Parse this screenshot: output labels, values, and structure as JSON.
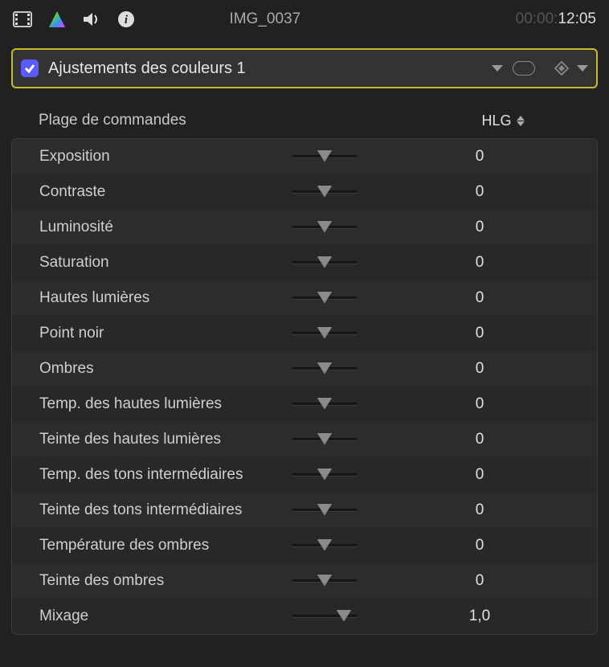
{
  "header": {
    "title": "IMG_0037",
    "time_dim": "00:00:",
    "time_bright": "12:05"
  },
  "effect": {
    "checked": true,
    "name": "Ajustements des couleurs 1"
  },
  "controls": {
    "range_label": "Plage de commandes",
    "range_value": "HLG"
  },
  "params": [
    {
      "label": "Exposition",
      "value": "0",
      "pos": 50
    },
    {
      "label": "Contraste",
      "value": "0",
      "pos": 50
    },
    {
      "label": "Luminosité",
      "value": "0",
      "pos": 50
    },
    {
      "label": "Saturation",
      "value": "0",
      "pos": 50
    },
    {
      "label": "Hautes lumières",
      "value": "0",
      "pos": 50
    },
    {
      "label": "Point noir",
      "value": "0",
      "pos": 50
    },
    {
      "label": "Ombres",
      "value": "0",
      "pos": 50
    },
    {
      "label": "Temp. des hautes lumières",
      "value": "0",
      "pos": 50
    },
    {
      "label": "Teinte des hautes lumières",
      "value": "0",
      "pos": 50
    },
    {
      "label": "Temp. des tons intermédiaires",
      "value": "0",
      "pos": 50
    },
    {
      "label": "Teinte des tons intermédiaires",
      "value": "0",
      "pos": 50
    },
    {
      "label": "Température des ombres",
      "value": "0",
      "pos": 50
    },
    {
      "label": "Teinte des ombres",
      "value": "0",
      "pos": 50
    },
    {
      "label": "Mixage",
      "value": "1,0",
      "pos": 80
    }
  ]
}
